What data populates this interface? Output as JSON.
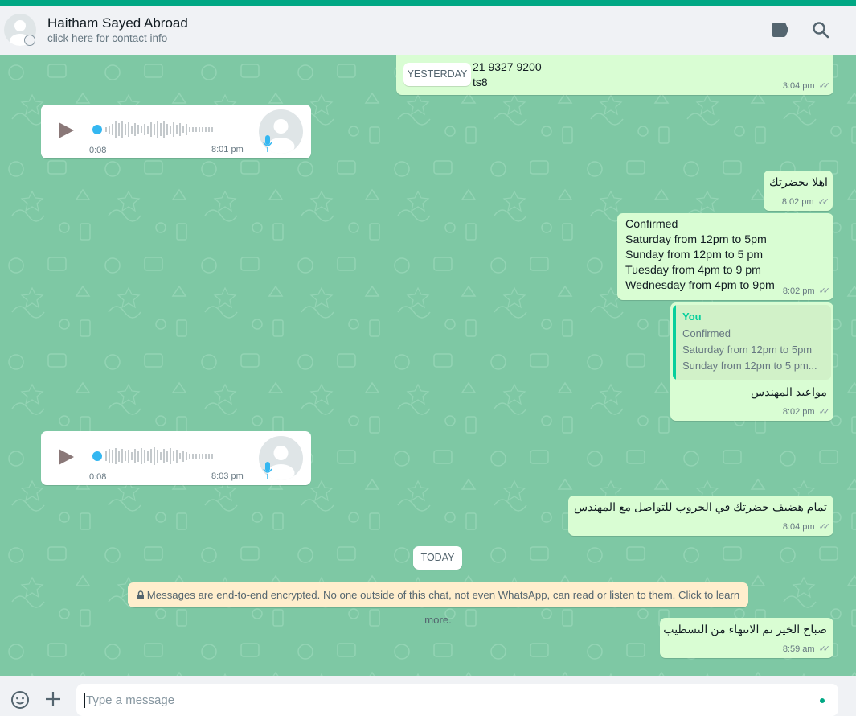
{
  "header": {
    "contact_name": "Haitham Sayed Abroad",
    "subtitle": "click here for contact info"
  },
  "messages": {
    "m1": {
      "line1": "21 9327 9200",
      "line2": "ts8",
      "time": "3:04 pm"
    },
    "date_yesterday": "YESTERDAY",
    "voice1": {
      "duration": "0:08",
      "time": "8:01 pm"
    },
    "m2": {
      "text": "اهلا بحضرتك",
      "time": "8:02 pm"
    },
    "m3": {
      "lines": [
        "Confirmed",
        "Saturday from 12pm to 5pm",
        "Sunday from 12pm to 5 pm",
        "Tuesday from 4pm to 9 pm",
        "Wednesday from 4pm to 9pm"
      ],
      "time": "8:02 pm"
    },
    "m4": {
      "quote_author": "You",
      "quote_lines": [
        "Confirmed",
        "Saturday from 12pm to 5pm",
        "Sunday from 12pm to 5 pm..."
      ],
      "text": "مواعيد المهندس",
      "time": "8:02 pm"
    },
    "voice2": {
      "duration": "0:08",
      "time": "8:03 pm"
    },
    "m5": {
      "text": "تمام هضيف حضرتك في الجروب للتواصل مع المهندس",
      "time": "8:04 pm"
    },
    "date_today": "TODAY",
    "encryption_notice": "Messages are end-to-end encrypted. No one outside of this chat, not even WhatsApp, can read or listen to them. Click to learn more.",
    "m6": {
      "text": "صباح الخير تم الانتهاء من التسطيب",
      "time": "8:59 am"
    }
  },
  "composer": {
    "placeholder": "Type a message"
  },
  "colors": {
    "accent": "#00a884",
    "chat_background": "#7ec8a4",
    "outgoing_bubble": "#d9fdd3",
    "incoming_bubble": "#ffffff",
    "encryption_banner": "#ffeecd",
    "voice_dot": "#34b7f1"
  },
  "icons": [
    "label-icon",
    "search-icon",
    "play-icon",
    "mic-icon",
    "lock-icon",
    "emoji-icon",
    "plus-icon",
    "double-tick-icon"
  ]
}
